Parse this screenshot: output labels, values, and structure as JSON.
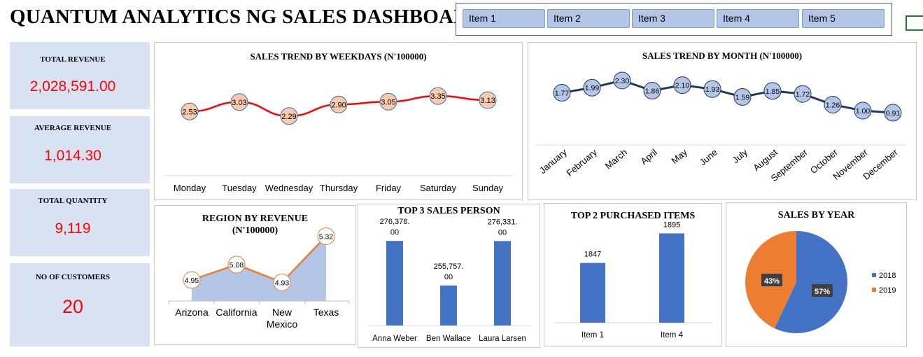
{
  "title": "QUANTUM ANALYTICS NG SALES DASHBOARD",
  "slicer": {
    "items": [
      "Item 1",
      "Item 2",
      "Item 3",
      "Item 4",
      "Item 5"
    ]
  },
  "kpis": [
    {
      "label": "TOTAL REVENUE",
      "value": "2,028,591.00"
    },
    {
      "label": "AVERAGE REVENUE",
      "value": "1,014.30"
    },
    {
      "label": "TOTAL QUANTITY",
      "value": "9,119"
    },
    {
      "label": "NO OF CUSTOMERS",
      "value": "20"
    }
  ],
  "colors": {
    "accent_red": "#ff0000",
    "kpi_bg": "#d9e2f3",
    "bar_blue": "#4472c4",
    "orange": "#ed7d31",
    "navy": "#1f3864",
    "slicer_btn": "#b4c6e7"
  },
  "chart_data": [
    {
      "type": "line",
      "title": "SALES TREND BY WEEKDAYS (N'100000)",
      "categories": [
        "Monday",
        "Tuesday",
        "Wednesday",
        "Thursday",
        "Friday",
        "Saturday",
        "Sunday"
      ],
      "values": [
        2.53,
        3.03,
        2.29,
        2.9,
        3.05,
        3.35,
        3.13
      ],
      "labels": [
        "2.53",
        "3.03",
        "2.29",
        "2.90",
        "3.05",
        "3.35",
        "3.13"
      ],
      "ylim": [
        1.8,
        3.8
      ]
    },
    {
      "type": "line",
      "title": "SALES TREND BY MONTH (N'100000)",
      "categories": [
        "January",
        "February",
        "March",
        "April",
        "May",
        "June",
        "July",
        "August",
        "September",
        "October",
        "November",
        "December"
      ],
      "values": [
        1.77,
        1.99,
        2.3,
        1.86,
        2.1,
        1.93,
        1.59,
        1.85,
        1.72,
        1.26,
        1.0,
        0.91
      ],
      "labels": [
        "1.77",
        "1.99",
        "2.30",
        "1.86",
        "2.10",
        "1.93",
        "1.59",
        "1.85",
        "1.72",
        "1.26",
        "1.00",
        "0.91"
      ],
      "ylim": [
        0.7,
        2.45
      ]
    },
    {
      "type": "area",
      "title": "REGION BY REVENUE (N'100000)",
      "categories": [
        "Arizona",
        "California",
        "New Mexico",
        "Texas"
      ],
      "values": [
        4.95,
        5.08,
        4.93,
        5.32
      ],
      "labels": [
        "4.95",
        "5.08",
        "4.93",
        "5.32"
      ],
      "ylim": [
        4.6,
        5.4
      ]
    },
    {
      "type": "bar",
      "title": "TOP 3 SALES PERSON",
      "categories": [
        "Anna Weber",
        "Ben Wallace",
        "Laura Larsen"
      ],
      "values": [
        276378.0,
        255757.0,
        276331.0
      ],
      "labels": [
        [
          "276,378.",
          "00"
        ],
        [
          "255,757.",
          "00"
        ],
        [
          "276,331.",
          "00"
        ]
      ],
      "ylim": [
        245000,
        280000
      ]
    },
    {
      "type": "bar",
      "title": "TOP 2 PURCHASED ITEMS",
      "categories": [
        "Item 1",
        "Item 4"
      ],
      "values": [
        1847,
        1895
      ],
      "labels": [
        "1847",
        "1895"
      ],
      "ylim": [
        1800,
        1900
      ]
    },
    {
      "type": "pie",
      "title": "SALES BY YEAR",
      "categories": [
        "2018",
        "2019"
      ],
      "values": [
        57,
        43
      ],
      "labels": [
        "57%",
        "43%"
      ],
      "legend": "right"
    }
  ]
}
